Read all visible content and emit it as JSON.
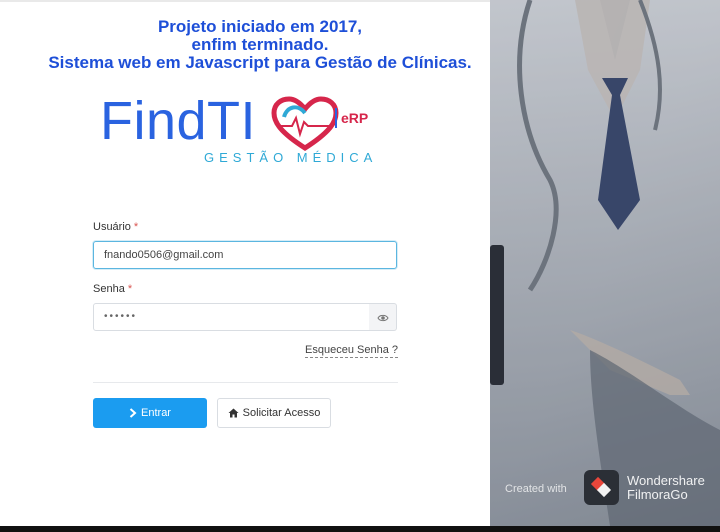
{
  "headline": {
    "line1": "Projeto iniciado em 2017,",
    "line2": "enfim terminado.",
    "line3": "Sistema web em Javascript para Gestão de Clínicas."
  },
  "logo": {
    "main": "FindTI",
    "badge": "eRP",
    "subtitle": "GESTÃO MÉDICA"
  },
  "form": {
    "username_label": "Usuário",
    "required_mark": "*",
    "username_value": "fnando0506@gmail.com",
    "password_label": "Senha",
    "password_value": "••••••",
    "forgot_link": "Esqueceu Senha ?",
    "login_button": "Entrar",
    "request_button": "Solicitar Acesso"
  },
  "watermark": {
    "created_with": "Created with",
    "brand_line1": "Wondershare",
    "brand_line2": "FilmoraGo"
  },
  "colors": {
    "headline": "#1e4fd8",
    "primary_button": "#1b9cf0",
    "logo_blue": "#2a63e0",
    "logo_red": "#d6264b",
    "logo_cyan": "#2fa9d6"
  },
  "icons": {
    "password_toggle": "eye-icon",
    "login": "chevron-right-icon",
    "request_access": "home-icon"
  }
}
